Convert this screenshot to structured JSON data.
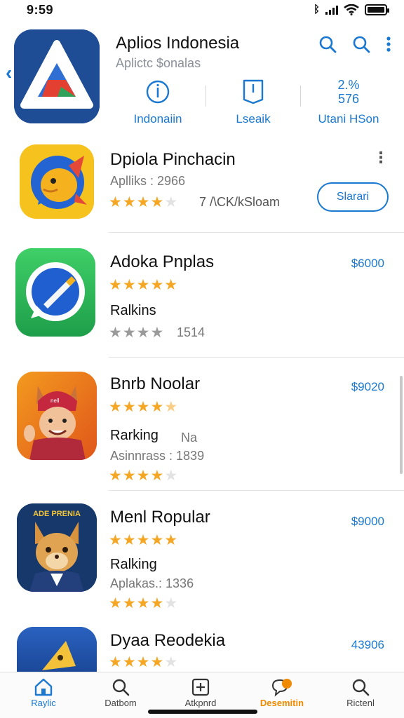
{
  "status": {
    "time": "9:59",
    "extra": "ᛒ"
  },
  "header": {
    "title": "Aplios Indonesia",
    "subtitle": "Aplictc $onalas",
    "back_icon": "chevron-left-icon",
    "actions": [
      "search-icon",
      "search-icon",
      "more-vertical-icon"
    ],
    "tabs": [
      {
        "label": "Indonaiin",
        "icon": "info-icon"
      },
      {
        "label": "Lseaik",
        "icon": "bookmark-icon"
      },
      {
        "label": "Utani HSon",
        "value_line1": "2.%",
        "value_line2": "576"
      }
    ]
  },
  "apps": [
    {
      "name": "Dpiola Pinchacin",
      "line1": "Aplliks : 2966",
      "stars": 4,
      "note": "7 /\\CK/kSloam",
      "button": "Slarari",
      "icon": "fish-chat-icon"
    },
    {
      "name": "Adoka Pnplas",
      "line1": "Ralkins",
      "stars": 5,
      "stars2": 4,
      "meta2": "1514",
      "price": "$6000",
      "icon": "messenger-pen-icon"
    },
    {
      "name": "Bnrb Noolar",
      "line1": "Rarking",
      "line1_note": "Na",
      "meta": "Asinnrass : 1839",
      "stars": 4.5,
      "stars2": 4,
      "price": "$9020",
      "icon": "fox-character-icon",
      "badge": "nell"
    },
    {
      "name": "Menl Ropular",
      "line1": "Ralking",
      "meta": "Aplakas.: 1336",
      "stars": 5,
      "stars2": 4,
      "price": "$9000",
      "icon": "fox-hero-icon",
      "icon_caption": "ADE PRENIA"
    },
    {
      "name": "Dyaa Reodekia",
      "stars": 4,
      "price": "43906",
      "icon": "shark-fin-icon"
    }
  ],
  "tabbar": [
    {
      "label": "Raylic",
      "icon": "home-icon",
      "state": "active"
    },
    {
      "label": "Datbom",
      "icon": "search-icon",
      "state": "normal"
    },
    {
      "label": "Atkpnrd",
      "icon": "plus-square-icon",
      "state": "normal"
    },
    {
      "label": "Desemitin",
      "icon": "chat-bubble-icon",
      "state": "orange"
    },
    {
      "label": "Rictenl",
      "icon": "search-icon",
      "state": "normal"
    }
  ],
  "colors": {
    "accent": "#1a78d0",
    "star": "#f5a623",
    "orange": "#f08a00"
  }
}
